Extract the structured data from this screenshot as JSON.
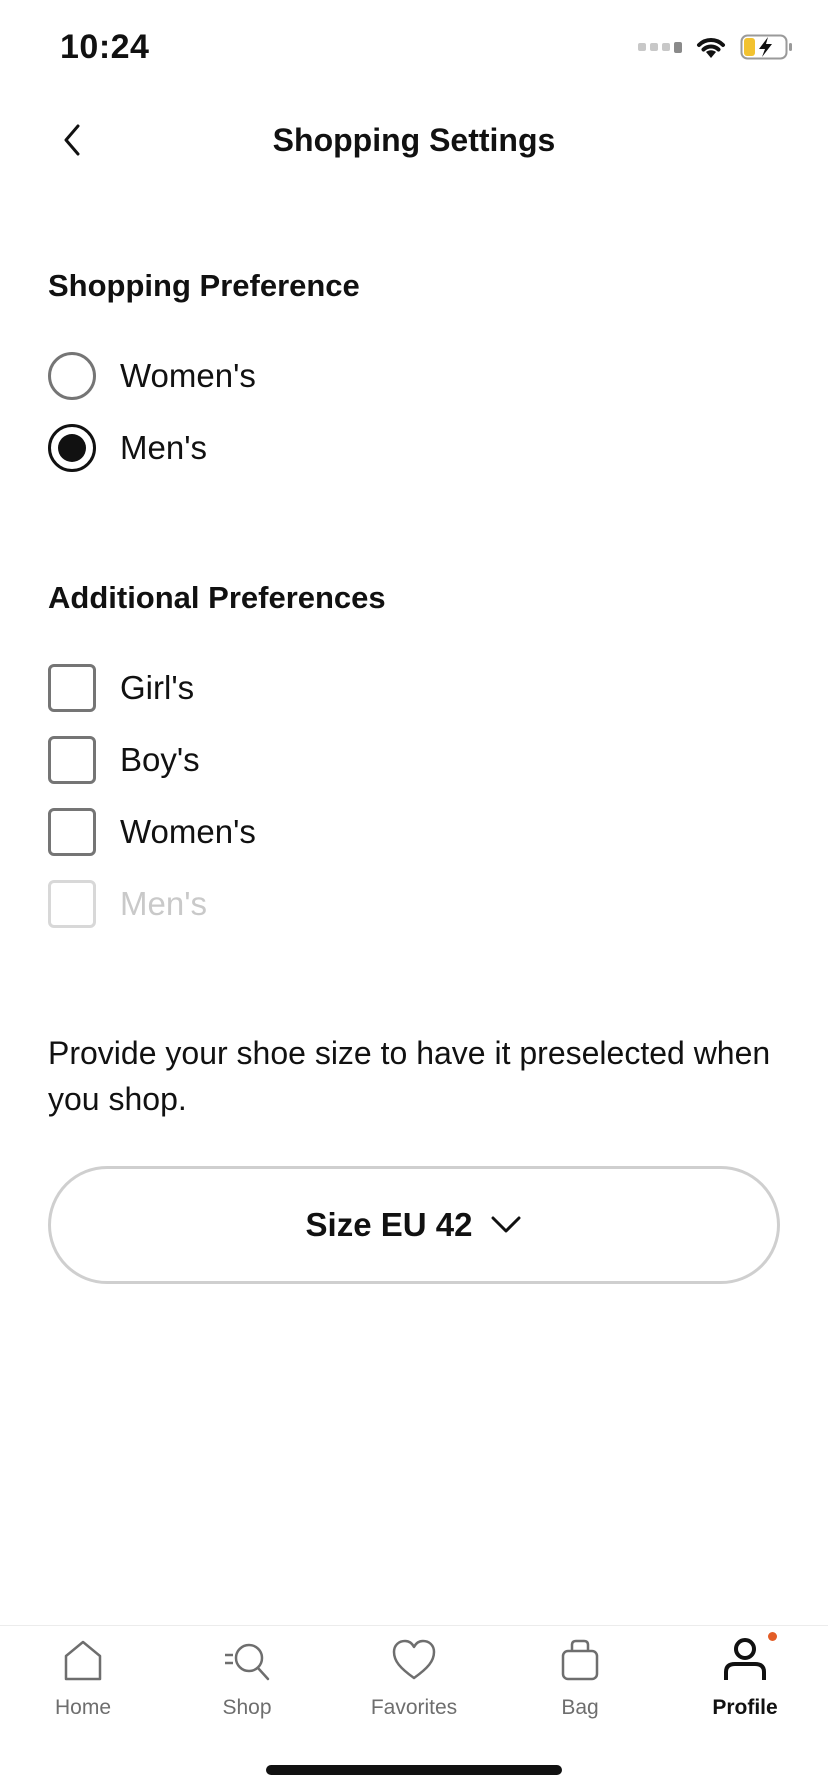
{
  "status_bar": {
    "time": "10:24"
  },
  "header": {
    "title": "Shopping Settings"
  },
  "shopping_preference": {
    "title": "Shopping Preference",
    "options": [
      {
        "label": "Women's",
        "selected": false
      },
      {
        "label": "Men's",
        "selected": true
      }
    ]
  },
  "additional_preferences": {
    "title": "Additional Preferences",
    "options": [
      {
        "label": "Girl's",
        "checked": false,
        "disabled": false
      },
      {
        "label": "Boy's",
        "checked": false,
        "disabled": false
      },
      {
        "label": "Women's",
        "checked": false,
        "disabled": false
      },
      {
        "label": "Men's",
        "checked": false,
        "disabled": true
      }
    ]
  },
  "shoe_size": {
    "helper_text": "Provide your shoe size to have it preselected when you shop.",
    "button_label": "Size EU 42"
  },
  "tab_bar": {
    "tabs": [
      {
        "label": "Home",
        "icon": "home-icon",
        "active": false
      },
      {
        "label": "Shop",
        "icon": "shop-search-icon",
        "active": false
      },
      {
        "label": "Favorites",
        "icon": "heart-icon",
        "active": false
      },
      {
        "label": "Bag",
        "icon": "bag-icon",
        "active": false
      },
      {
        "label": "Profile",
        "icon": "profile-icon",
        "active": true
      }
    ]
  },
  "colors": {
    "accent_dot": "#e35d27",
    "battery_fill": "#f2c230"
  }
}
